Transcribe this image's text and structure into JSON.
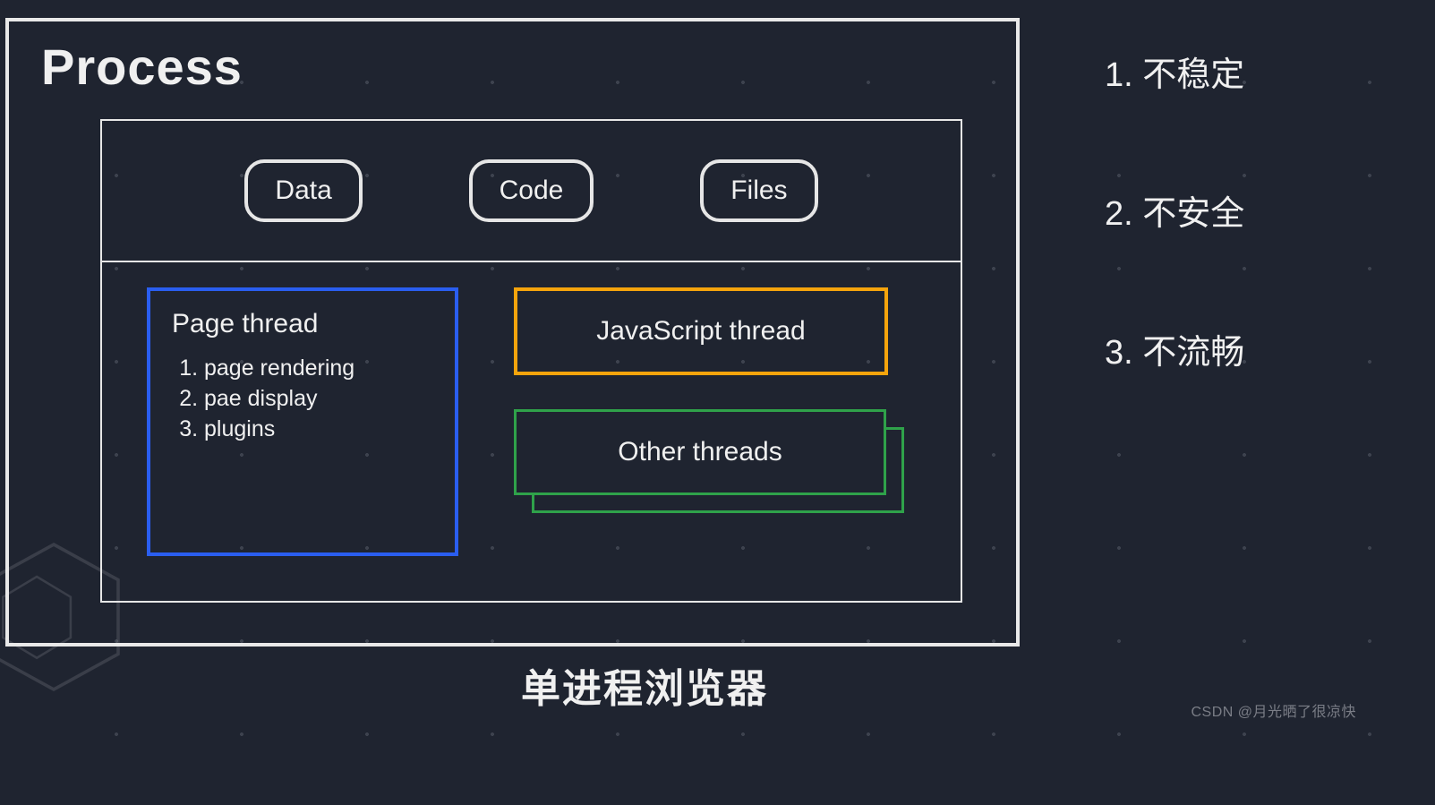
{
  "process": {
    "title": "Process",
    "resources": [
      "Data",
      "Code",
      "Files"
    ],
    "page_thread": {
      "title": "Page thread",
      "items": [
        "page rendering",
        "pae display",
        "plugins"
      ]
    },
    "js_thread": {
      "title": "JavaScript thread"
    },
    "other_threads": {
      "title": "Other threads"
    }
  },
  "right_list": [
    "1. 不稳定",
    "2. 不安全",
    "3. 不流畅"
  ],
  "caption": "单进程浏览器",
  "watermark": "CSDN @月光晒了很凉快"
}
